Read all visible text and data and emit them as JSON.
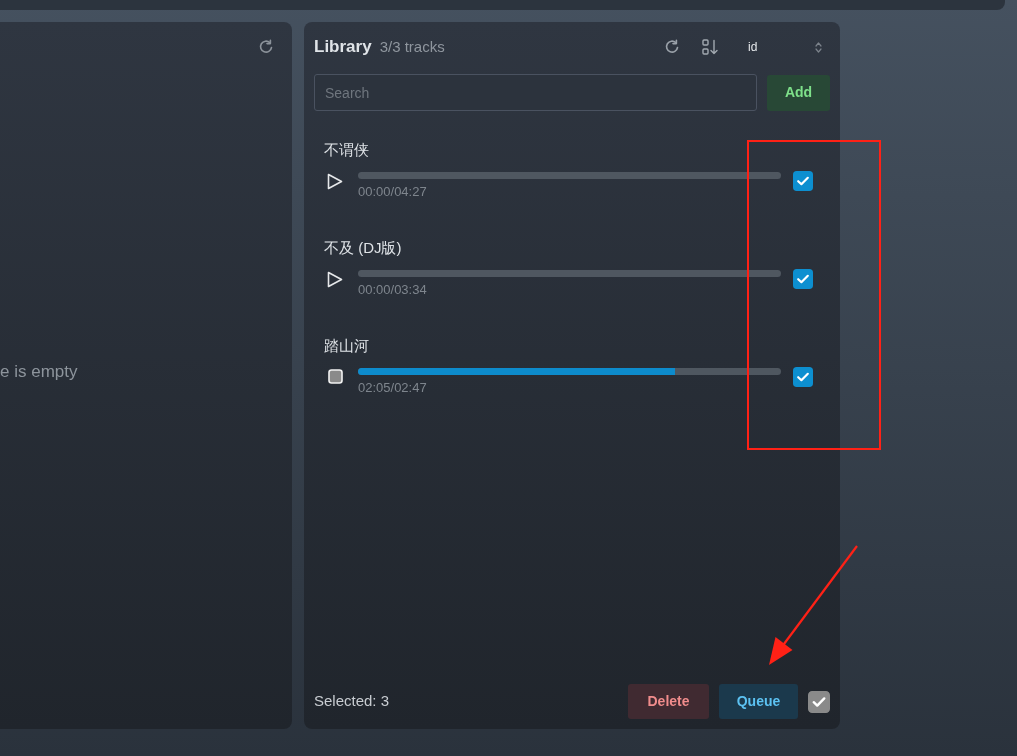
{
  "queue_panel": {
    "empty_message": "e is empty"
  },
  "library": {
    "title": "Library",
    "count": "3/3 tracks",
    "sort_field": "id",
    "search": {
      "placeholder": "Search"
    },
    "add_button": "Add",
    "tracks": [
      {
        "title": "不谓侠",
        "time": "00:00/04:27",
        "level": 0,
        "playing": false,
        "checked": true
      },
      {
        "title": "不及 (DJ版)",
        "time": "00:00/03:34",
        "level": 0,
        "playing": false,
        "checked": true
      },
      {
        "title": "踏山河",
        "time": "02:05/02:47",
        "level": 0.749,
        "playing": true,
        "checked": true
      }
    ],
    "footer": {
      "selected": "Selected: 3",
      "buttons": [
        {
          "label": "Delete",
          "kind": "danger"
        },
        {
          "label": "Queue",
          "kind": "primary"
        }
      ],
      "select_all": {
        "checked": true
      }
    }
  },
  "annotations": {
    "highlight_frame": true,
    "arrow": true
  }
}
